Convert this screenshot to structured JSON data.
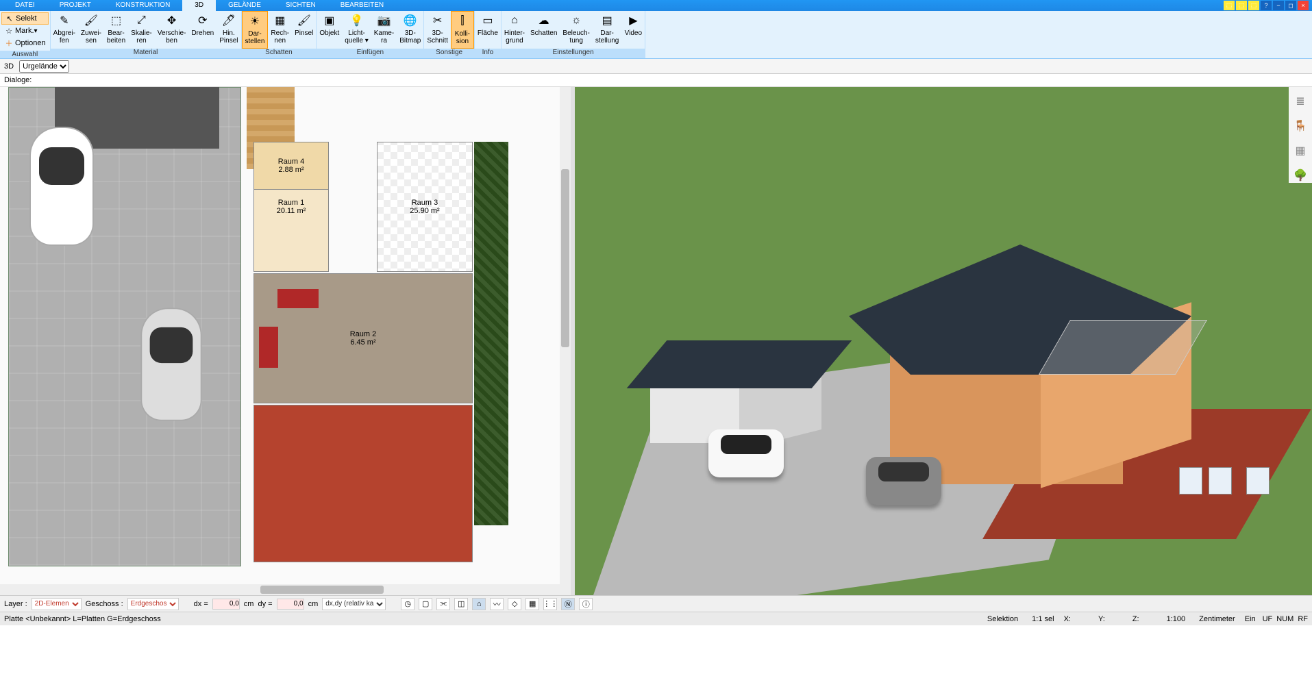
{
  "menu": {
    "tabs": [
      "DATEI",
      "PROJEKT",
      "KONSTRUKTION",
      "3D",
      "GELÄNDE",
      "SICHTEN",
      "BEARBEITEN"
    ],
    "active": 3
  },
  "ribbon": {
    "auswahl": {
      "label": "Auswahl",
      "selekt": "Selekt",
      "mark": "Mark.",
      "optionen": "Optionen"
    },
    "material": {
      "label": "Material",
      "tools": [
        {
          "id": "abgreifen",
          "l1": "Abgrei-",
          "l2": "fen",
          "icon": "✎"
        },
        {
          "id": "zuweisen",
          "l1": "Zuwei-",
          "l2": "sen",
          "icon": "🖌"
        },
        {
          "id": "bearbeiten",
          "l1": "Bear-",
          "l2": "beiten",
          "icon": "⬚"
        },
        {
          "id": "skalieren",
          "l1": "Skalie-",
          "l2": "ren",
          "icon": "⤢"
        },
        {
          "id": "verschieben",
          "l1": "Verschie-",
          "l2": "ben",
          "icon": "✥"
        },
        {
          "id": "drehen",
          "l1": "Drehen",
          "l2": "",
          "icon": "⟳"
        },
        {
          "id": "pinsel",
          "l1": "Hin.",
          "l2": "Pinsel",
          "icon": "🖊"
        }
      ]
    },
    "schatten": {
      "label": "Schatten",
      "tools": [
        {
          "id": "darstellen",
          "l1": "Dar-",
          "l2": "stellen",
          "icon": "☀",
          "active": true
        },
        {
          "id": "rechnen",
          "l1": "Rech-",
          "l2": "nen",
          "icon": "▦"
        },
        {
          "id": "pinsel2",
          "l1": "Pinsel",
          "l2": "",
          "icon": "🖌"
        }
      ]
    },
    "einfuegen": {
      "label": "Einfügen",
      "tools": [
        {
          "id": "objekt",
          "l1": "Objekt",
          "l2": "",
          "icon": "▣"
        },
        {
          "id": "licht",
          "l1": "Licht-",
          "l2": "quelle ▾",
          "icon": "💡"
        },
        {
          "id": "kamera",
          "l1": "Kame-",
          "l2": "ra",
          "icon": "📷"
        },
        {
          "id": "3dbitmap",
          "l1": "3D-",
          "l2": "Bitmap",
          "icon": "🌐"
        }
      ]
    },
    "sonstige": {
      "label": "Sonstige",
      "tools": [
        {
          "id": "3dschnitt",
          "l1": "3D-",
          "l2": "Schnitt",
          "icon": "✂"
        },
        {
          "id": "kollision",
          "l1": "Kolli-",
          "l2": "sion",
          "icon": "⫿",
          "active": true
        }
      ]
    },
    "info": {
      "label": "Info",
      "tools": [
        {
          "id": "flaeche",
          "l1": "Fläche",
          "l2": "",
          "icon": "▭"
        }
      ]
    },
    "einstellungen": {
      "label": "Einstellungen",
      "tools": [
        {
          "id": "hintergrund",
          "l1": "Hinter-",
          "l2": "grund",
          "icon": "⌂"
        },
        {
          "id": "schatten2",
          "l1": "Schatten",
          "l2": "",
          "icon": "☁"
        },
        {
          "id": "beleuchtung",
          "l1": "Beleuch-",
          "l2": "tung",
          "icon": "☼"
        },
        {
          "id": "darstellung",
          "l1": "Dar-",
          "l2": "stellung",
          "icon": "▤"
        },
        {
          "id": "video",
          "l1": "Video",
          "l2": "",
          "icon": "▶"
        }
      ]
    }
  },
  "subribbon": {
    "mode": "3D",
    "layer_select": "Urgelände"
  },
  "dialogbar": {
    "label": "Dialoge:"
  },
  "rooms": {
    "r1": {
      "name": "Raum 1",
      "area": "20.11 m²"
    },
    "r2": {
      "name": "Raum 2",
      "area": "6.45 m²"
    },
    "r3": {
      "name": "Raum 3",
      "area": "25.90 m²"
    },
    "r4": {
      "name": "Raum 4",
      "area": "2.88 m²"
    }
  },
  "right_toolbar": [
    {
      "id": "layers",
      "icon": "≣"
    },
    {
      "id": "furniture",
      "icon": "🪑"
    },
    {
      "id": "materials",
      "icon": "▦"
    },
    {
      "id": "plants",
      "icon": "🌳"
    }
  ],
  "bottombar": {
    "layer_label": "Layer :",
    "layer_value": "2D-Elemen",
    "geschoss_label": "Geschoss :",
    "geschoss_value": "Erdgeschos",
    "dx_label": "dx =",
    "dx_value": "0,0",
    "dy_label": "dy =",
    "dy_value": "0,0",
    "unit": "cm",
    "hint": "dx,dy (relativ ka"
  },
  "statusbar": {
    "left": "Platte <Unbekannt> L=Platten G=Erdgeschoss",
    "sel": "Selektion",
    "ratio": "1:1 sel",
    "x": "X:",
    "y": "Y:",
    "z": "Z:",
    "scale": "1:100",
    "unit": "Zentimeter",
    "ein": "Ein",
    "uf": "UF",
    "num": "NUM",
    "rf": "RF"
  }
}
